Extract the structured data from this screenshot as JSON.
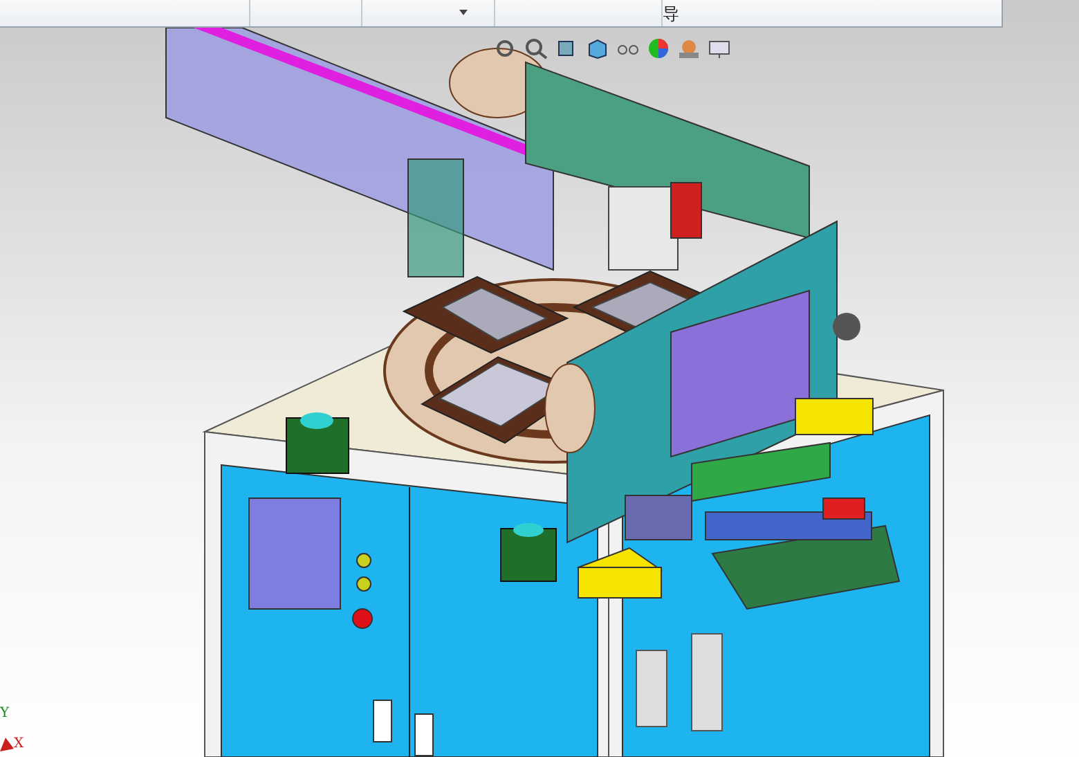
{
  "ribbon": {
    "label_fragment": "导"
  },
  "axis_triad": {
    "y_label": "Y",
    "x_label": "X"
  }
}
